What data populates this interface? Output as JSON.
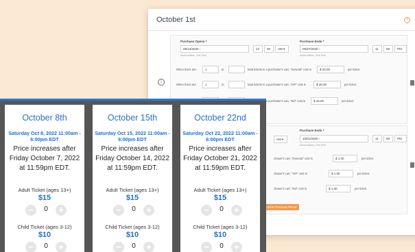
{
  "admin": {
    "title": "October 1st",
    "periods": [
      {
        "opens_label": "Purchase Opens *",
        "opens_date": "09/13/2020",
        "opens_hour": "12",
        "opens_min": "00",
        "opens_ampm": "AM",
        "ends_label": "Purchase Ends *",
        "ends_date": "09/27/2020",
        "ends_hour": "11",
        "ends_min": "59",
        "ends_ampm": "PM",
        "timezone": "America/New_York Time",
        "rules": [
          {
            "pre": "When there are",
            "from": "1",
            "to_word": "to",
            "to": "",
            "mid": "total tickets in a purchaser's cart, \"General\" cost is",
            "cur": "$",
            "price": "20.00",
            "post": "per ticket."
          },
          {
            "pre": "When there are",
            "from": "1",
            "to_word": "to",
            "to": "",
            "mid": "total tickets in a purchaser's cart, \"VIP\" cost is",
            "cur": "$",
            "price": "30.00",
            "post": "per ticket."
          },
          {
            "pre": "When there are",
            "from": "1",
            "to_word": "to",
            "to": "",
            "mid": "total tickets in a purchaser's cart, \"Kid\" cost is",
            "cur": "$",
            "price": "15.00",
            "post": "per ticket."
          }
        ]
      },
      {
        "ends_label": "Purchase Ends *",
        "opens_ampm": "AM",
        "ends_date": "10/01/2020",
        "ends_hour": "11",
        "ends_min": "59",
        "ends_ampm": "PM",
        "timezone": "America/New_York Time",
        "rules": [
          {
            "mid": "chaser's cart, \"General\" cost is",
            "cur": "$",
            "price": "1.00",
            "post": "per ticket."
          },
          {
            "mid": "chaser's cart, \"VIP\" cost is",
            "cur": "$",
            "price": "1.00",
            "post": "per ticket."
          },
          {
            "mid": "chaser's cart, \"Kid\" cost is",
            "cur": "$",
            "price": "1.00",
            "post": "per ticket."
          }
        ]
      }
    ],
    "add_period_label": "dd Another Purchase Period"
  },
  "cards": [
    {
      "title": "October 8th",
      "date": "Saturday Oct 8, 2022 11:00am - 6:00pm EDT",
      "note": "Price increases after Friday October 7, 2022 at 11:59pm EDT.",
      "adult_label": "Adult Ticket (ages 13+)",
      "adult_price": "$15",
      "adult_qty": "0",
      "child_label": "Child Ticket (ages 3-12)",
      "child_price": "$10",
      "child_qty": "0"
    },
    {
      "title": "October 15th",
      "date": "Saturday Oct 15, 2022 11:00am - 6:00pm EDT",
      "note": "Price increases after Friday October 14, 2022 at 11:59pm EDT.",
      "adult_label": "Adult Ticket (ages 13+)",
      "adult_price": "$15",
      "adult_qty": "0",
      "child_label": "Child Ticket (ages 3-12)",
      "child_price": "$10",
      "child_qty": "0"
    },
    {
      "title": "October 22nd",
      "date": "Saturday Oct 22, 2022 11:00am - 6:00pm EDT",
      "note": "Price increases after Friday October 21, 2022 at 11:59pm EDT.",
      "adult_label": "Adult Ticket (ages 13+)",
      "adult_price": "$15",
      "adult_qty": "0",
      "child_label": "Child Ticket (ages 3-12)",
      "child_price": "$10",
      "child_qty": "0"
    }
  ],
  "icons": {
    "minus": "−",
    "plus": "+",
    "info": "i",
    "close": "×",
    "calendar": "▫",
    "caret": "▾"
  },
  "colors": {
    "accent_blue": "#1f6fd1",
    "orange": "#f2994a",
    "background": "#fbe9d4",
    "card_frame": "#565656"
  }
}
